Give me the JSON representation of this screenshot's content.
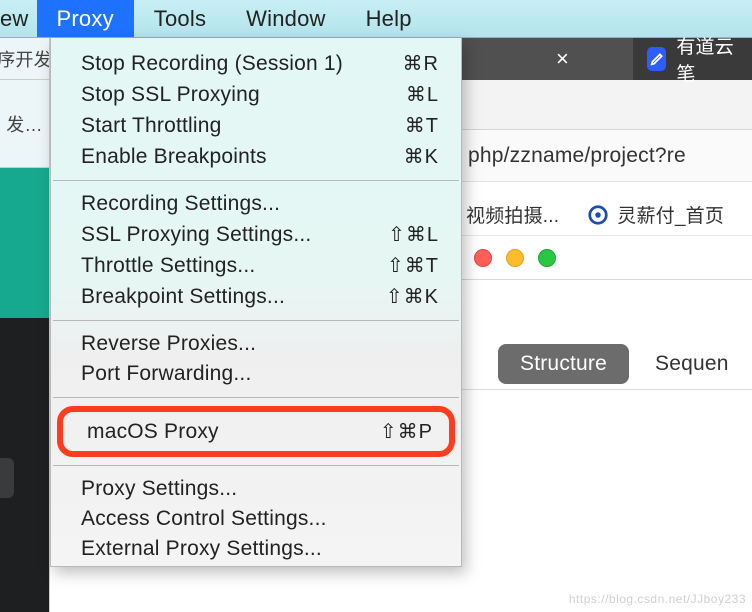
{
  "menubar": {
    "items": [
      "ew",
      "Proxy",
      "Tools",
      "Window",
      "Help"
    ],
    "selected_index": 1
  },
  "left": {
    "top_text": "序开发",
    "mid_text": "发…"
  },
  "dropdown": {
    "groups": [
      [
        {
          "label": "Stop Recording (Session 1)",
          "shortcut": "⌘R"
        },
        {
          "label": "Stop SSL Proxying",
          "shortcut": "⌘L"
        },
        {
          "label": "Start Throttling",
          "shortcut": "⌘T"
        },
        {
          "label": "Enable Breakpoints",
          "shortcut": "⌘K"
        }
      ],
      [
        {
          "label": "Recording Settings...",
          "shortcut": ""
        },
        {
          "label": "SSL Proxying Settings...",
          "shortcut": "⇧⌘L"
        },
        {
          "label": "Throttle Settings...",
          "shortcut": "⇧⌘T"
        },
        {
          "label": "Breakpoint Settings...",
          "shortcut": "⇧⌘K"
        }
      ],
      [
        {
          "label": "Reverse Proxies...",
          "shortcut": ""
        },
        {
          "label": "Port Forwarding...",
          "shortcut": ""
        }
      ],
      [
        {
          "label": "macOS Proxy",
          "shortcut": "⇧⌘P",
          "highlighted": true
        }
      ],
      [
        {
          "label": "Proxy Settings...",
          "shortcut": ""
        },
        {
          "label": "Access Control Settings...",
          "shortcut": ""
        },
        {
          "label": "External Proxy Settings...",
          "shortcut": ""
        }
      ]
    ]
  },
  "right": {
    "tab_close": "×",
    "tab_new_label": "有道云笔",
    "address": "php/zzname/project?re",
    "bookmarks": [
      {
        "label": "视频拍摄..."
      },
      {
        "label": "灵薪付_首页"
      }
    ],
    "structure_btn": "Structure",
    "structure_other": "Sequen"
  },
  "watermark": "https://blog.csdn.net/JJboy233"
}
